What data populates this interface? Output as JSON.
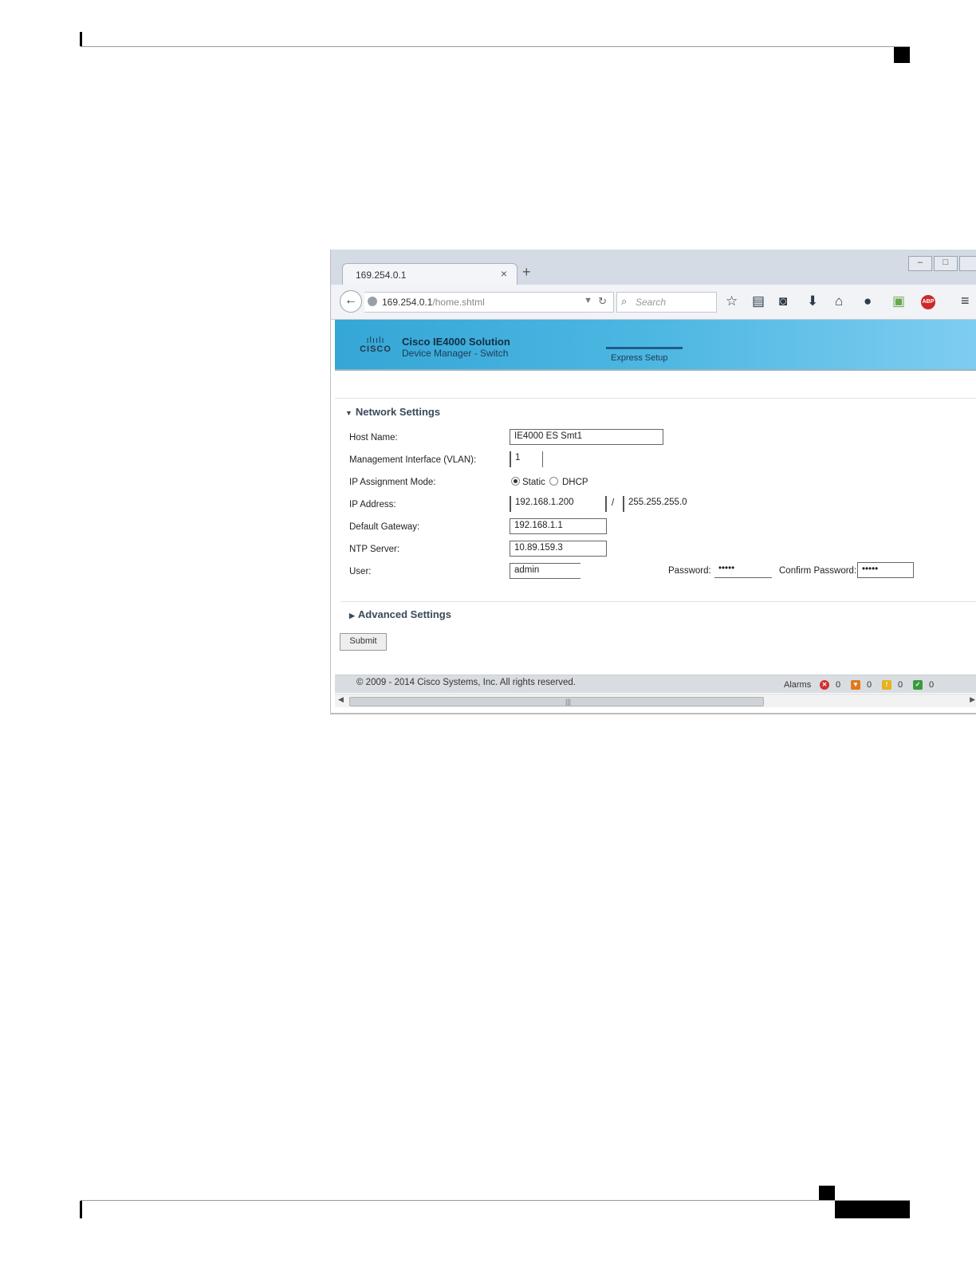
{
  "browser": {
    "tab_title": "169.254.0.1",
    "tab_close": "×",
    "new_tab": "+",
    "window_buttons": [
      "–",
      "□"
    ],
    "url_host": "169.254.0.1",
    "url_path": "/home.shtml",
    "search_placeholder": "Search"
  },
  "banner": {
    "logo_bars": "ılıılı",
    "logo_word": "CISCO",
    "title": "Cisco IE4000 Solution",
    "subtitle": "Device Manager - Switch",
    "tab": "Express Setup"
  },
  "network": {
    "heading": "Network Settings",
    "host_name_label": "Host Name:",
    "host_name": "IE4000 ES Smt1",
    "mgmt_label": "Management Interface (VLAN):",
    "mgmt_value": "1",
    "ip_mode_label": "IP Assignment Mode:",
    "ip_mode_static": "Static",
    "ip_mode_dhcp": "DHCP",
    "ip_label": "IP Address:",
    "ip_value": "192.168.1.200",
    "mask_sep": "/",
    "mask_value": "255.255.255.0",
    "gateway_label": "Default Gateway:",
    "gateway_value": "192.168.1.1",
    "ntp_label": "NTP Server:",
    "ntp_value": "10.89.159.3",
    "user_label": "User:",
    "user_value": "admin",
    "password_label": "Password:",
    "password_value": "•••••",
    "confirm_label": "Confirm Password:",
    "confirm_value": "•••••"
  },
  "advanced": {
    "heading": "Advanced Settings"
  },
  "submit_label": "Submit",
  "footer": {
    "copyright": "© 2009 - 2014 Cisco Systems, Inc. All rights reserved.",
    "alarms_label": "Alarms",
    "counts": [
      "0",
      "0",
      "0",
      "0"
    ]
  }
}
